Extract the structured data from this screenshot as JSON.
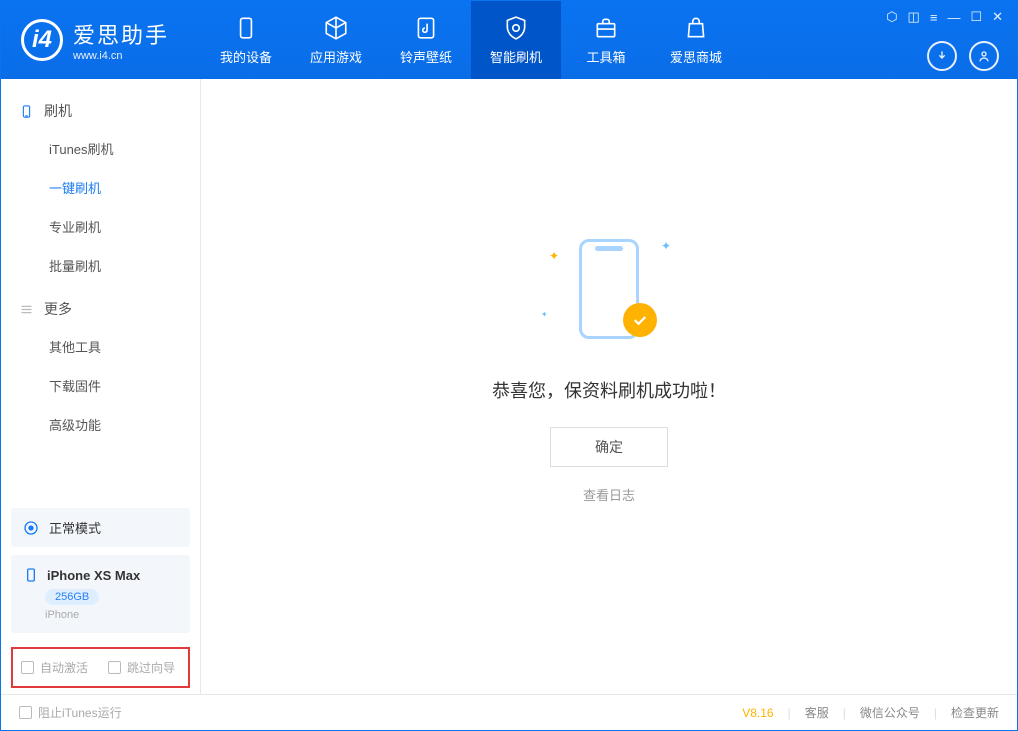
{
  "app": {
    "name": "爱思助手",
    "url": "www.i4.cn"
  },
  "nav": {
    "tabs": [
      {
        "label": "我的设备"
      },
      {
        "label": "应用游戏"
      },
      {
        "label": "铃声壁纸"
      },
      {
        "label": "智能刷机"
      },
      {
        "label": "工具箱"
      },
      {
        "label": "爱思商城"
      }
    ]
  },
  "sidebar": {
    "section1": {
      "title": "刷机",
      "items": [
        "iTunes刷机",
        "一键刷机",
        "专业刷机",
        "批量刷机"
      ]
    },
    "section2": {
      "title": "更多",
      "items": [
        "其他工具",
        "下载固件",
        "高级功能"
      ]
    },
    "mode": "正常模式",
    "device": {
      "name": "iPhone XS Max",
      "storage": "256GB",
      "type": "iPhone"
    },
    "options": {
      "auto_activate": "自动激活",
      "skip_guide": "跳过向导"
    }
  },
  "main": {
    "success": "恭喜您，保资料刷机成功啦！",
    "ok": "确定",
    "view_log": "查看日志"
  },
  "footer": {
    "block_itunes": "阻止iTunes运行",
    "version": "V8.16",
    "links": [
      "客服",
      "微信公众号",
      "检查更新"
    ]
  }
}
